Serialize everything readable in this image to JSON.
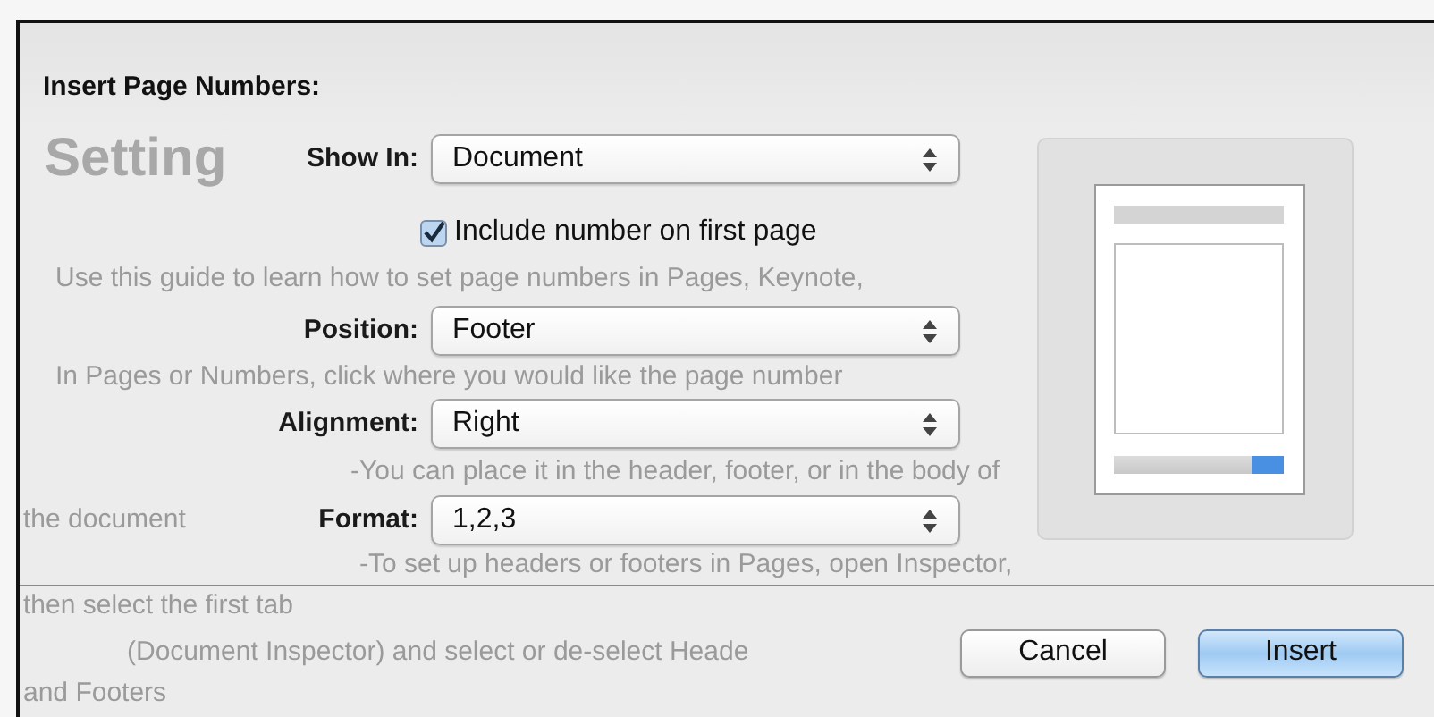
{
  "background_document": {
    "title_fragment": "Setting",
    "lines": [
      "Use this guide to learn how to set page numbers in Pages, Keynote,",
      "In Pages or Numbers, click where you would like the page number",
      "-You can place it in the header, footer, or in the body of",
      "the document",
      "-To set up headers or footers in Pages, open Inspector,",
      "then select the first tab",
      "(Document Inspector) and select or de-select Heade",
      "and Footers"
    ]
  },
  "dialog": {
    "title": "Insert Page Numbers:",
    "fields": [
      {
        "label": "Show In:",
        "value": "Document"
      },
      {
        "label": "Position:",
        "value": "Footer"
      },
      {
        "label": "Alignment:",
        "value": "Right"
      },
      {
        "label": "Format:",
        "value": "1,2,3"
      }
    ],
    "checkbox": {
      "label": "Include number on first page",
      "checked": true
    },
    "buttons": [
      {
        "label": "Cancel",
        "default": false
      },
      {
        "label": "Insert",
        "default": true
      }
    ]
  }
}
